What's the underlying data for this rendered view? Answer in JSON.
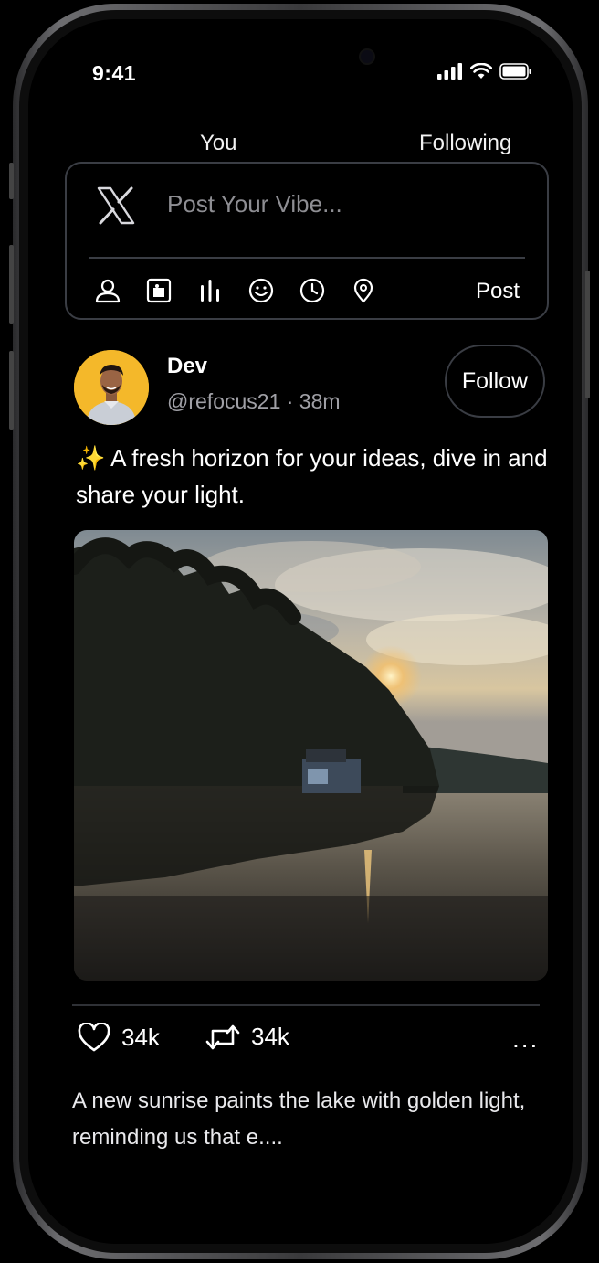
{
  "status_bar": {
    "time": "9:41"
  },
  "tabs": [
    {
      "label": "You"
    },
    {
      "label": "Following"
    }
  ],
  "composer": {
    "placeholder": "Post Your Vibe...",
    "post_label": "Post",
    "tools": [
      "profile-icon",
      "image-icon",
      "poll-icon",
      "emoji-icon",
      "schedule-icon",
      "location-icon"
    ]
  },
  "post": {
    "author_name": "Dev",
    "author_meta": "@refocus21 · 38m",
    "follow_label": "Follow",
    "emoji": "✨",
    "text": " A fresh horizon for your ideas, dive in and share your light.",
    "likes": "34k",
    "reposts": "34k",
    "more": "..."
  },
  "next_post": {
    "text": "A new sunrise paints the lake with golden light, reminding us that e...."
  },
  "colors": {
    "background": "#000000",
    "border": "#3a3d44",
    "muted": "#8e8e93",
    "avatar_bg": "#f4b82a"
  }
}
